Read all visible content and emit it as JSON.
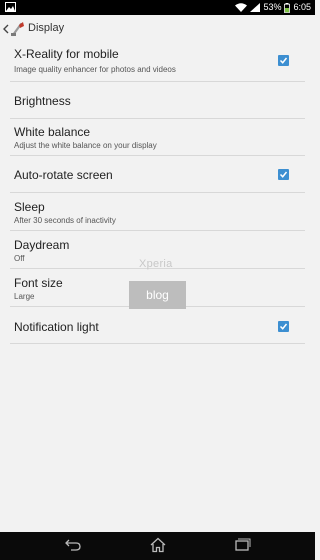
{
  "status_bar": {
    "battery_percent": "53%",
    "time": "6:05"
  },
  "action_bar": {
    "title": "Display"
  },
  "settings": [
    {
      "title": "X-Reality for mobile",
      "subtitle": "Image quality enhancer for photos and videos",
      "checked": true
    },
    {
      "title": "Brightness",
      "subtitle": ""
    },
    {
      "title": "White balance",
      "subtitle": "Adjust the white balance on your display"
    },
    {
      "title": "Auto-rotate screen",
      "subtitle": "",
      "checked": true
    },
    {
      "title": "Sleep",
      "subtitle": "After 30 seconds of inactivity"
    },
    {
      "title": "Daydream",
      "subtitle": "Off"
    },
    {
      "title": "Font size",
      "subtitle": "Large"
    },
    {
      "title": "Notification light",
      "subtitle": "",
      "checked": true
    }
  ],
  "watermark": {
    "line1": "Xperia",
    "line2": "blog"
  },
  "icons": {
    "status_left": "image-icon",
    "wifi": "wifi-icon",
    "signal": "signal-icon",
    "battery": "battery-icon",
    "back": "back-icon",
    "home": "home-icon",
    "recents": "recents-icon",
    "app": "display-settings-icon"
  },
  "colors": {
    "checkbox": "#3d8fd1",
    "background": "#f2f2f2",
    "status_bar": "#000000",
    "battery_charge": "#7dc242"
  }
}
